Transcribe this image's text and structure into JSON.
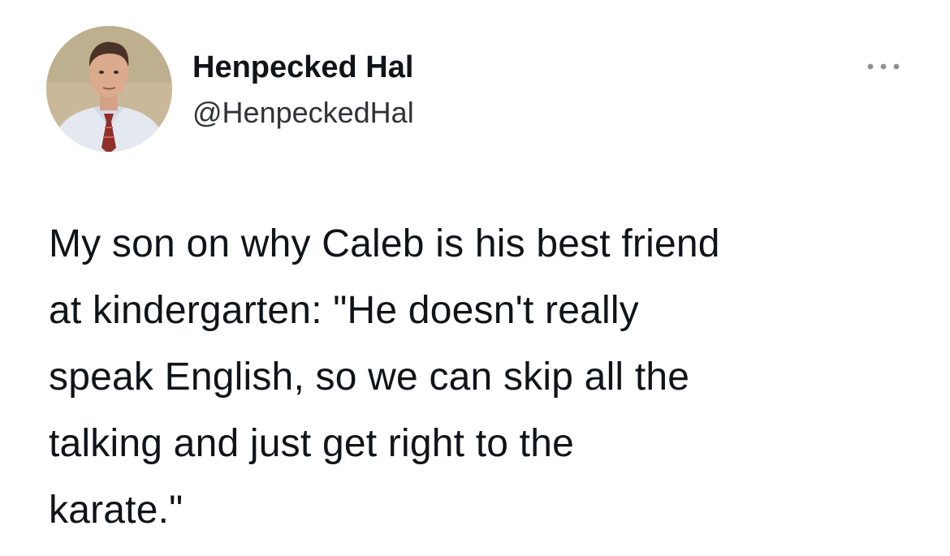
{
  "tweet": {
    "author": {
      "display_name": "Henpecked Hal",
      "handle": "@HenpeckedHal",
      "avatar_icon": "profile-photo"
    },
    "more_icon": "ellipsis-icon",
    "text": "My son on why Caleb is his best friend\nat kindergarten: \"He doesn't really\nspeak English, so we can skip all the\ntalking and just get right to the\nkarate.\""
  },
  "colors": {
    "background": "#ffffff",
    "text_primary": "#0f1419",
    "text_secondary": "#2f3336",
    "icon_muted": "#8b9196"
  }
}
